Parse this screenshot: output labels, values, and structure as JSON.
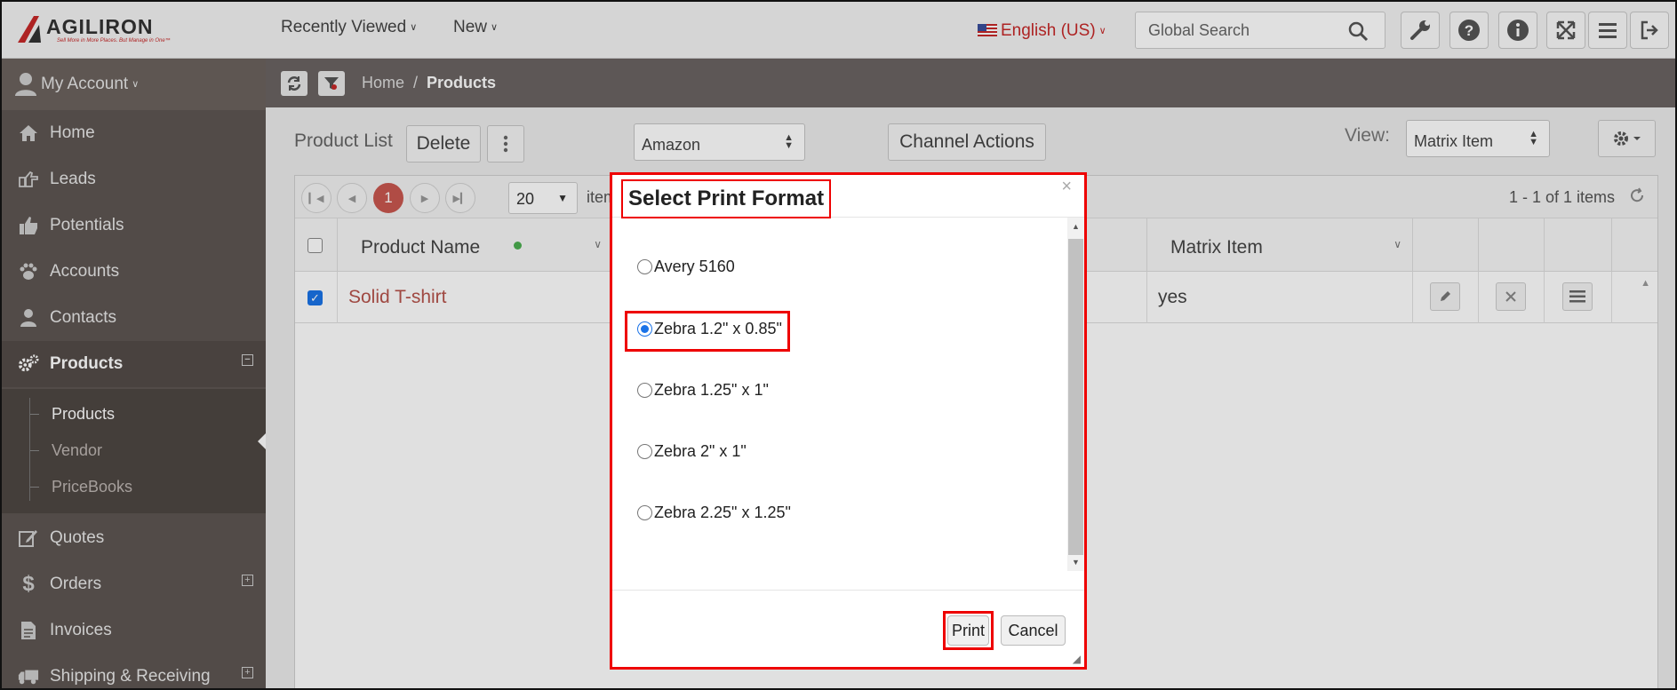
{
  "header": {
    "logo_text": "AGILIRON",
    "logo_tagline": "Sell More in More Places. But Manage in One™",
    "recently_viewed": "Recently Viewed",
    "new_label": "New",
    "language": "English (US)",
    "search_placeholder": "Global Search",
    "icons": [
      "wrench-icon",
      "help-icon",
      "info-icon",
      "expand-icon",
      "menu-icon",
      "logout-icon"
    ]
  },
  "sidebar": {
    "account": "My Account",
    "items": [
      {
        "label": "Home",
        "icon": "home-icon"
      },
      {
        "label": "Leads",
        "icon": "thumb-pointing-icon"
      },
      {
        "label": "Potentials",
        "icon": "thumbs-up-icon"
      },
      {
        "label": "Accounts",
        "icon": "paw-icon"
      },
      {
        "label": "Contacts",
        "icon": "user-icon"
      },
      {
        "label": "Products",
        "icon": "gears-icon"
      },
      {
        "label": "Quotes",
        "icon": "edit-icon"
      },
      {
        "label": "Orders",
        "icon": "dollar-icon"
      },
      {
        "label": "Invoices",
        "icon": "file-icon"
      },
      {
        "label": "Shipping & Receiving",
        "icon": "truck-icon"
      }
    ],
    "subitems": [
      "Products",
      "Vendor",
      "PriceBooks"
    ]
  },
  "breadcrumb": {
    "home": "Home",
    "sep": "/",
    "current": "Products"
  },
  "toolbar": {
    "title": "Product List",
    "delete": "Delete",
    "channel": "Amazon",
    "channel_actions": "Channel Actions",
    "view_label": "View:",
    "view_value": "Matrix Item"
  },
  "pager": {
    "page": "1",
    "page_size": "20",
    "items_label": "items per page",
    "count": "1 - 1 of 1 items"
  },
  "table": {
    "columns": [
      "Product Name",
      "Matrix Item"
    ],
    "rows": [
      {
        "name": "Solid T-shirt",
        "matrix": "yes",
        "checked": true
      }
    ]
  },
  "modal": {
    "title": "Select Print Format",
    "close": "×",
    "options": [
      "Avery 5160",
      "Zebra 1.2\" x 0.85\"",
      "Zebra 1.25\" x 1\"",
      "Zebra 2\" x 1\"",
      "Zebra 2.25\" x 1.25\""
    ],
    "selected_index": 1,
    "print": "Print",
    "cancel": "Cancel"
  },
  "colors": {
    "sidebar": "#5e5652",
    "accent_red": "#c9574f",
    "highlight": "#ee0000",
    "link": "#b5524a"
  }
}
